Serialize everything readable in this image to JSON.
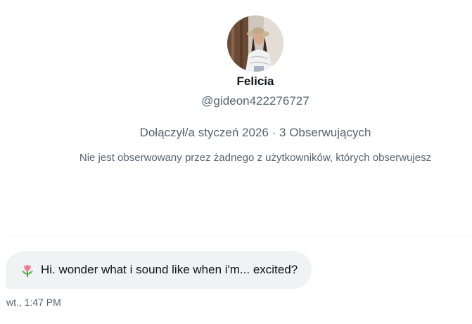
{
  "profile": {
    "name": "Felicia",
    "handle": "@gideon422276727",
    "joined": "Dołączył/a styczeń 2026",
    "separator": "·",
    "followers": "3 Obserwujących",
    "mutuals_note": "Nie jest obserwowany przez żadnego z użytkowników, których obserwujesz"
  },
  "message": {
    "emoji_icon": "tulip-icon",
    "text": "Hi. wonder what i sound like when i'm... excited?",
    "timestamp": "wt., 1:47 PM"
  },
  "colors": {
    "primary_text": "#0f1419",
    "secondary_text": "#536471",
    "bubble_bg": "#eff3f4",
    "divider": "#eff3f4"
  }
}
